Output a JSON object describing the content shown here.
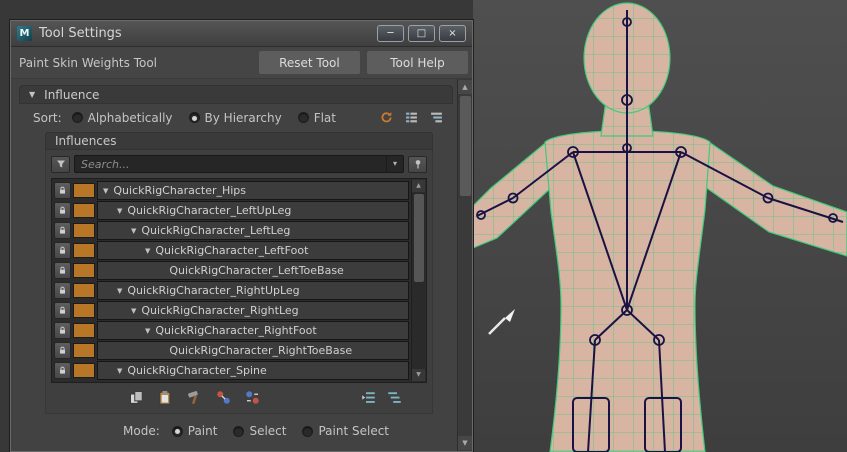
{
  "window": {
    "title": "Tool Settings",
    "logo_glyph": "M",
    "controls": {
      "minimize": "─",
      "maximize": "□",
      "close": "×"
    }
  },
  "toolbar": {
    "tool_name": "Paint Skin Weights Tool",
    "reset_label": "Reset Tool",
    "help_label": "Tool Help"
  },
  "influence": {
    "header": "Influence",
    "twisty_glyph": "▼",
    "sort_label": "Sort:",
    "sort_options": [
      {
        "label": "Alphabetically",
        "selected": false
      },
      {
        "label": "By Hierarchy",
        "selected": true
      },
      {
        "label": "Flat",
        "selected": false
      }
    ],
    "influences_header": "Influences",
    "search_placeholder": "Search...",
    "dropdown_glyph": "▾",
    "swatch_color": "#b87627",
    "tree": [
      {
        "label": "QuickRigCharacter_Hips",
        "depth": 0,
        "expandable": true
      },
      {
        "label": "QuickRigCharacter_LeftUpLeg",
        "depth": 1,
        "expandable": true
      },
      {
        "label": "QuickRigCharacter_LeftLeg",
        "depth": 2,
        "expandable": true
      },
      {
        "label": "QuickRigCharacter_LeftFoot",
        "depth": 3,
        "expandable": true
      },
      {
        "label": "QuickRigCharacter_LeftToeBase",
        "depth": 4,
        "expandable": false
      },
      {
        "label": "QuickRigCharacter_RightUpLeg",
        "depth": 1,
        "expandable": true
      },
      {
        "label": "QuickRigCharacter_RightLeg",
        "depth": 2,
        "expandable": true
      },
      {
        "label": "QuickRigCharacter_RightFoot",
        "depth": 3,
        "expandable": true
      },
      {
        "label": "QuickRigCharacter_RightToeBase",
        "depth": 4,
        "expandable": false
      },
      {
        "label": "QuickRigCharacter_Spine",
        "depth": 1,
        "expandable": true
      }
    ]
  },
  "mode": {
    "label": "Mode:",
    "options": [
      {
        "label": "Paint",
        "selected": true
      },
      {
        "label": "Select",
        "selected": false
      },
      {
        "label": "Paint Select",
        "selected": false
      }
    ]
  },
  "scrollbar": {
    "up": "▲",
    "down": "▼"
  },
  "colors": {
    "skin": "#d7b5a2",
    "wire": "#3ecb7c",
    "bone": "#1a1244",
    "swatch": "#b87627"
  }
}
